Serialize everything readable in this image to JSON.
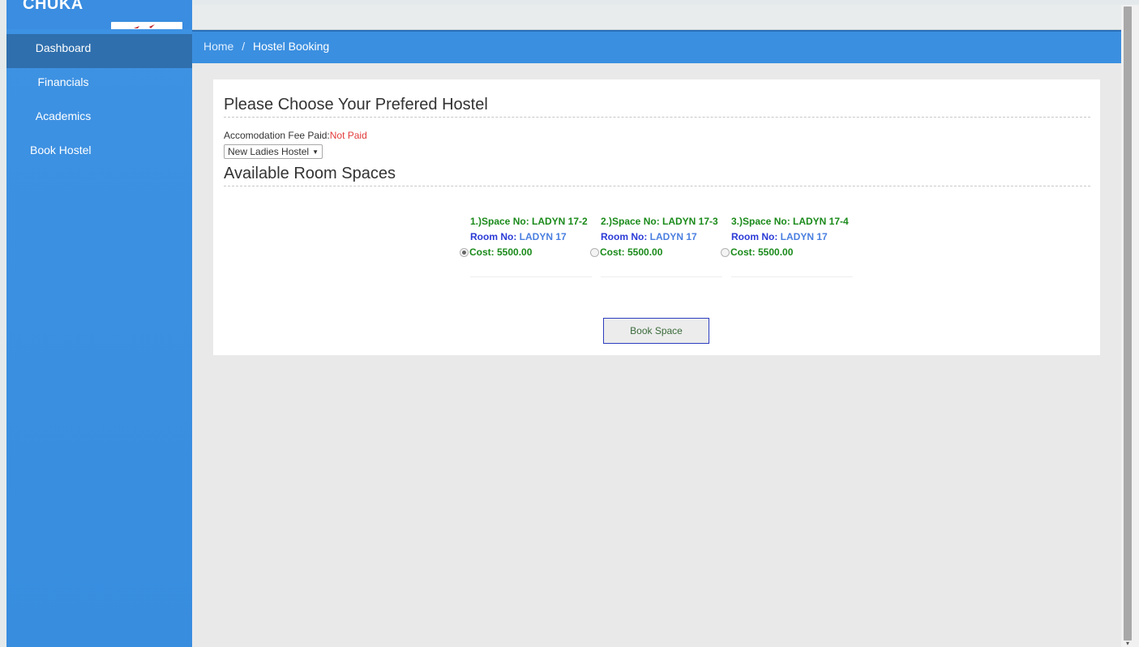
{
  "brand": {
    "name": "CHUKA"
  },
  "sidebar": {
    "items": [
      {
        "label": "Dashboard"
      },
      {
        "label": "Financials"
      },
      {
        "label": "Academics"
      },
      {
        "label": "Book Hostel"
      }
    ]
  },
  "breadcrumb": {
    "home": "Home",
    "separator": "/",
    "current": "Hostel Booking"
  },
  "main": {
    "title": "Please Choose Your Prefered Hostel",
    "fee_label": "Accomodation Fee Paid:",
    "fee_status": "Not Paid",
    "hostel_select": {
      "selected": "New Ladies Hostel"
    },
    "spaces_title": "Available Room Spaces",
    "spaces": [
      {
        "number": "1.)Space No: LADYN 17-2",
        "room_label": "Room No:",
        "room_value": "LADYN 17",
        "cost": "Cost: 5500.00",
        "selected": true
      },
      {
        "number": "2.)Space No: LADYN 17-3",
        "room_label": "Room No:",
        "room_value": "LADYN 17",
        "cost": "Cost: 5500.00",
        "selected": false
      },
      {
        "number": "3.)Space No: LADYN 17-4",
        "room_label": "Room No:",
        "room_value": "LADYN 17",
        "cost": "Cost: 5500.00",
        "selected": false
      }
    ],
    "book_button": "Book Space"
  },
  "colors": {
    "sidebar": "#3b8fe0",
    "sidebar_active": "#2f6fad",
    "status_not_paid": "#e23a3a",
    "space_green": "#1a8a1a",
    "room_blue": "#2b3bd6"
  }
}
